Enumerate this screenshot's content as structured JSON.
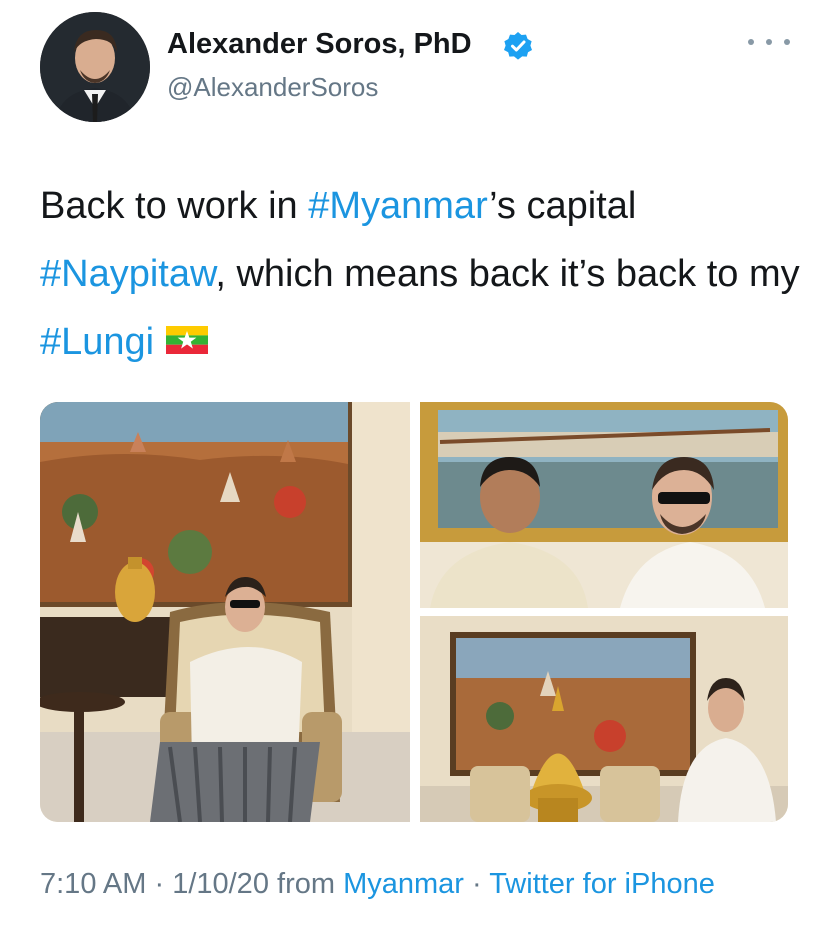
{
  "tweet": {
    "display_name": "Alexander Soros, PhD",
    "handle": "@AlexanderSoros",
    "text_parts": {
      "p1": "Back to work in ",
      "h1": "#Myanmar",
      "p2": "’s capital ",
      "h2": "#Naypitaw",
      "p3": ", which means back it’s back to my ",
      "h3": "#Lungi"
    },
    "flag_icon": "myanmar-flag-emoji",
    "verified_icon": "verified-badge-icon",
    "more_icon": "more-options-icon",
    "photos": [
      {
        "name": "photo-left-seated-lungi"
      },
      {
        "name": "photo-top-right-handshake"
      },
      {
        "name": "photo-bottom-right-standing"
      }
    ],
    "footer": {
      "time": "7:10 AM",
      "sep1": " · ",
      "date": "1/10/20",
      "from": " from ",
      "location": "Myanmar",
      "sep2": " · ",
      "source": "Twitter for iPhone"
    }
  },
  "colors": {
    "text": "#14171a",
    "secondary": "#657786",
    "link": "#1b95e0",
    "verified": "#1da1f2"
  }
}
